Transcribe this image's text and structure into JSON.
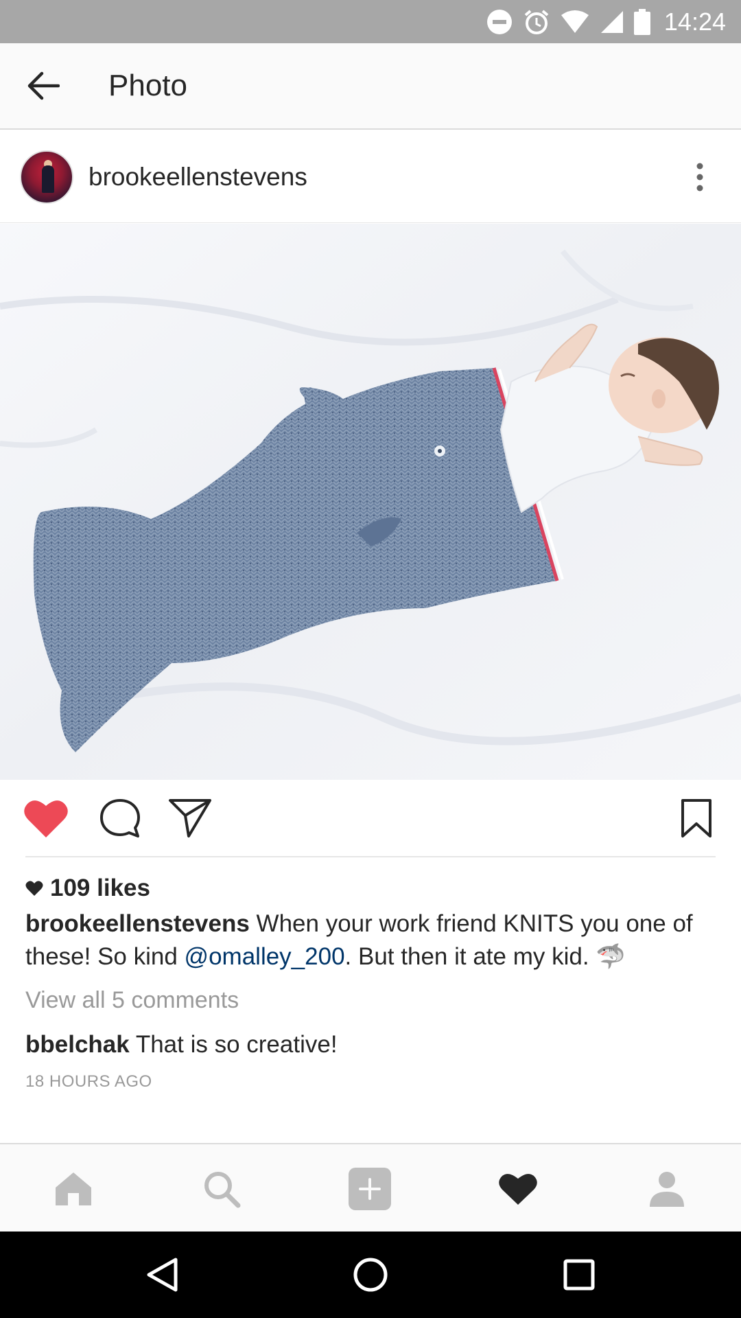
{
  "status_bar": {
    "time": "14:24",
    "icons": [
      "do-not-disturb-icon",
      "alarm-icon",
      "wifi-icon",
      "signal-icon",
      "battery-icon"
    ]
  },
  "header": {
    "title": "Photo",
    "back_icon": "arrow-left-icon"
  },
  "post": {
    "username": "brookeellenstevens",
    "more_icon": "more-vertical-icon",
    "photo_alt": "photo",
    "liked": true,
    "likes_text": "109 likes",
    "caption": {
      "username": "brookeellenstevens",
      "text_before_mention": " When your work friend KNITS you one of these! So kind ",
      "mention": "@omalley_200",
      "text_after_mention": ". But then it ate my kid. ",
      "emoji": "🦈"
    },
    "view_comments": "View all 5 comments",
    "comment": {
      "username": "bbelchak",
      "text": " That is so creative!"
    },
    "timestamp": "18 HOURS AGO"
  },
  "actions": {
    "like_icon": "heart-filled-icon",
    "comment_icon": "comment-icon",
    "share_icon": "send-icon",
    "save_icon": "bookmark-icon"
  },
  "tabs": [
    {
      "name": "home",
      "icon": "home-icon"
    },
    {
      "name": "search",
      "icon": "search-icon"
    },
    {
      "name": "add",
      "icon": "add-post-icon"
    },
    {
      "name": "activity",
      "icon": "heart-icon",
      "active": true
    },
    {
      "name": "profile",
      "icon": "profile-icon"
    }
  ],
  "colors": {
    "heart_red": "#ed4956",
    "mention_blue": "#003569",
    "muted_gray": "#999999",
    "status_bar": "#a7a7a7",
    "tab_icon_inactive": "#bdbdbd"
  },
  "system_nav": [
    "back-triangle-icon",
    "home-circle-icon",
    "recents-square-icon"
  ]
}
